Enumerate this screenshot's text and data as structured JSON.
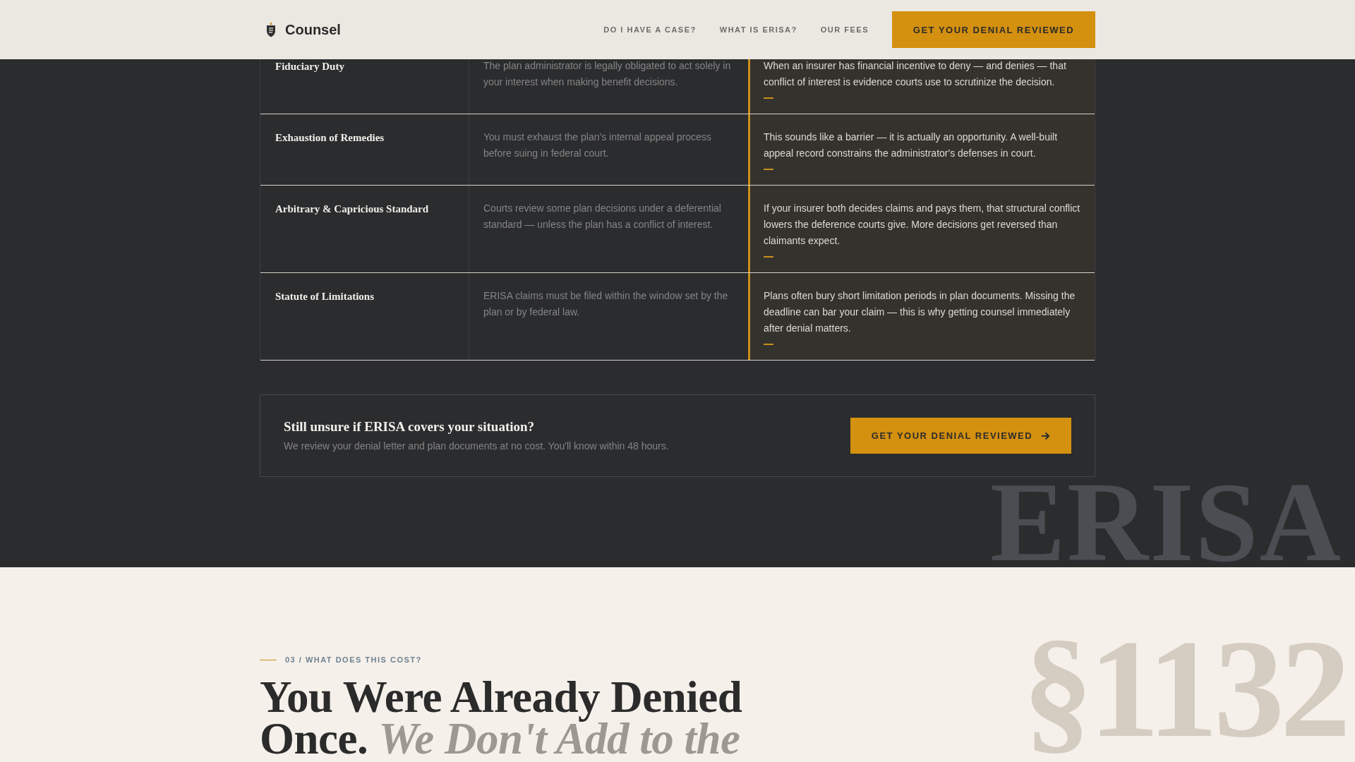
{
  "header": {
    "brand": "Counsel",
    "nav": [
      {
        "label": "DO I HAVE A CASE?"
      },
      {
        "label": "WHAT IS ERISA?"
      },
      {
        "label": "OUR FEES"
      }
    ],
    "cta": "GET YOUR DENIAL REVIEWED"
  },
  "terms_table": {
    "rows": [
      {
        "term": "Fiduciary Duty",
        "definition": "The plan administrator is legally obligated to act solely in your interest when making benefit decisions.",
        "insight": "When an insurer has financial incentive to deny — and denies — that conflict of interest is evidence courts use to scrutinize the decision."
      },
      {
        "term": "Exhaustion of Remedies",
        "definition": "You must exhaust the plan's internal appeal process before suing in federal court.",
        "insight": "This sounds like a barrier — it is actually an opportunity. A well-built appeal record constrains the administrator's defenses in court."
      },
      {
        "term": "Arbitrary & Capricious Standard",
        "definition": "Courts review some plan decisions under a deferential standard — unless the plan has a conflict of interest.",
        "insight": "If your insurer both decides claims and pays them, that structural conflict lowers the deference courts give. More decisions get reversed than claimants expect."
      },
      {
        "term": "Statute of Limitations",
        "definition": "ERISA claims must be filed within the window set by the plan or by federal law.",
        "insight": "Plans often bury short limitation periods in plan documents. Missing the deadline can bar your claim — this is why getting counsel immediately after denial matters."
      }
    ]
  },
  "cta_panel": {
    "title": "Still unsure if ERISA covers your situation?",
    "text": "We review your denial letter and plan documents at no cost. You'll know within 48 hours.",
    "button": "GET YOUR DENIAL REVIEWED"
  },
  "backdrop_text": "ERISA",
  "fees_section": {
    "eyebrow": "03 / WHAT DOES THIS COST?",
    "heading": "You Were Already Denied Once. *We Don't Add to the*",
    "backdrop_text": "§1132"
  }
}
